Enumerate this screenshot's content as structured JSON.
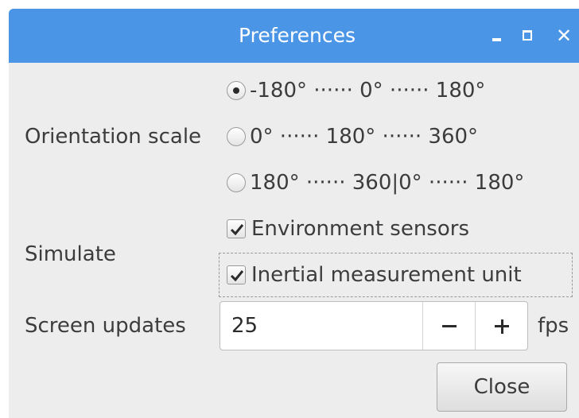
{
  "window": {
    "title": "Preferences",
    "accent_color": "#4b95e6",
    "controls": {
      "minimize_icon": "minimize-icon",
      "maximize_icon": "maximize-icon",
      "close_glyph": "✕"
    }
  },
  "orientation": {
    "label": "Orientation scale",
    "options": [
      {
        "label": "-180° ······ 0° ······ 180°",
        "selected": true
      },
      {
        "label": "0° ······ 180° ······ 360°",
        "selected": false
      },
      {
        "label": "180° ······ 360|0° ······ 180°",
        "selected": false
      }
    ]
  },
  "simulate": {
    "label": "Simulate",
    "options": [
      {
        "label": "Environment sensors",
        "checked": true
      },
      {
        "label": "Inertial measurement unit",
        "checked": true
      }
    ]
  },
  "screen_updates": {
    "label": "Screen updates",
    "value": "25",
    "unit": "fps"
  },
  "buttons": {
    "close_label": "Close"
  }
}
